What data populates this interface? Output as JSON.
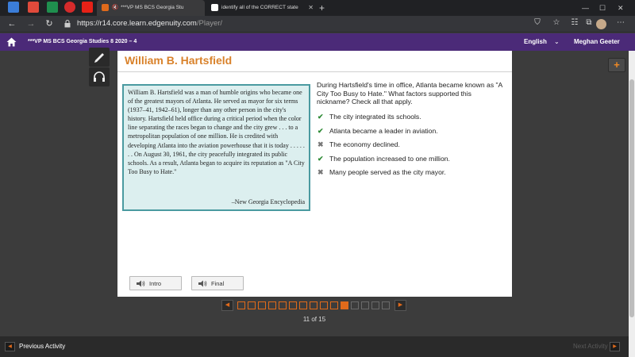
{
  "browser": {
    "tabs": [
      {
        "label": "***VP MS BCS Georgia Stu",
        "active": true
      },
      {
        "label": "identify all of the CORRECT state",
        "active": false
      }
    ],
    "new_tab_symbol": "+",
    "url_host": "https://r14.core.learn.edgenuity.com",
    "url_path": "/Player/"
  },
  "appbar": {
    "course_title": "***VP MS BCS Georgia Studies 8 2020 – 4",
    "language": "English",
    "user_name": "Meghan Geeter"
  },
  "card": {
    "title": "William B. Hartsfield",
    "passage": "William B. Hartsfield was a man of humble origins who became one of the greatest mayors of Atlanta. He served as mayor for six terms (1937–41, 1942–61), longer than any other person in the city's history. Hartsfield held office during a critical period when the color line separating the races began to change and the city grew . . . to a metropolitan population of one million. He is credited with developing Atlanta into the aviation powerhouse that it is today . . . . . . . On August 30, 1961, the city peacefully integrated its public schools. As a result, Atlanta began to acquire its reputation as \"A City Too Busy to Hate.\"",
    "source": "–New Georgia Encyclopedia",
    "question": "During Hartsfield's time in office, Atlanta became known as \"A City Too Busy to Hate.\" What factors supported this nickname? Check all that apply.",
    "answers": [
      {
        "text": "The city integrated its schools.",
        "mark": "check",
        "icon": "check-icon"
      },
      {
        "text": "Atlanta became a leader in aviation.",
        "mark": "check",
        "icon": "check-icon"
      },
      {
        "text": "The economy declined.",
        "mark": "cross",
        "icon": "cross-icon"
      },
      {
        "text": "The population increased to one million.",
        "mark": "check",
        "icon": "check-icon"
      },
      {
        "text": "Many people served as the city mayor.",
        "mark": "cross",
        "icon": "cross-icon"
      }
    ],
    "intro_label": "Intro",
    "final_label": "Final"
  },
  "pager": {
    "current": 11,
    "total": 15,
    "label": "11 of 15"
  },
  "footer": {
    "prev_label": "Previous Activity",
    "next_label": "Next Activity"
  },
  "colors": {
    "accent": "#e06a1b",
    "appbar": "#4b2a78",
    "title": "#d9822b",
    "check": "#2e8b36"
  }
}
